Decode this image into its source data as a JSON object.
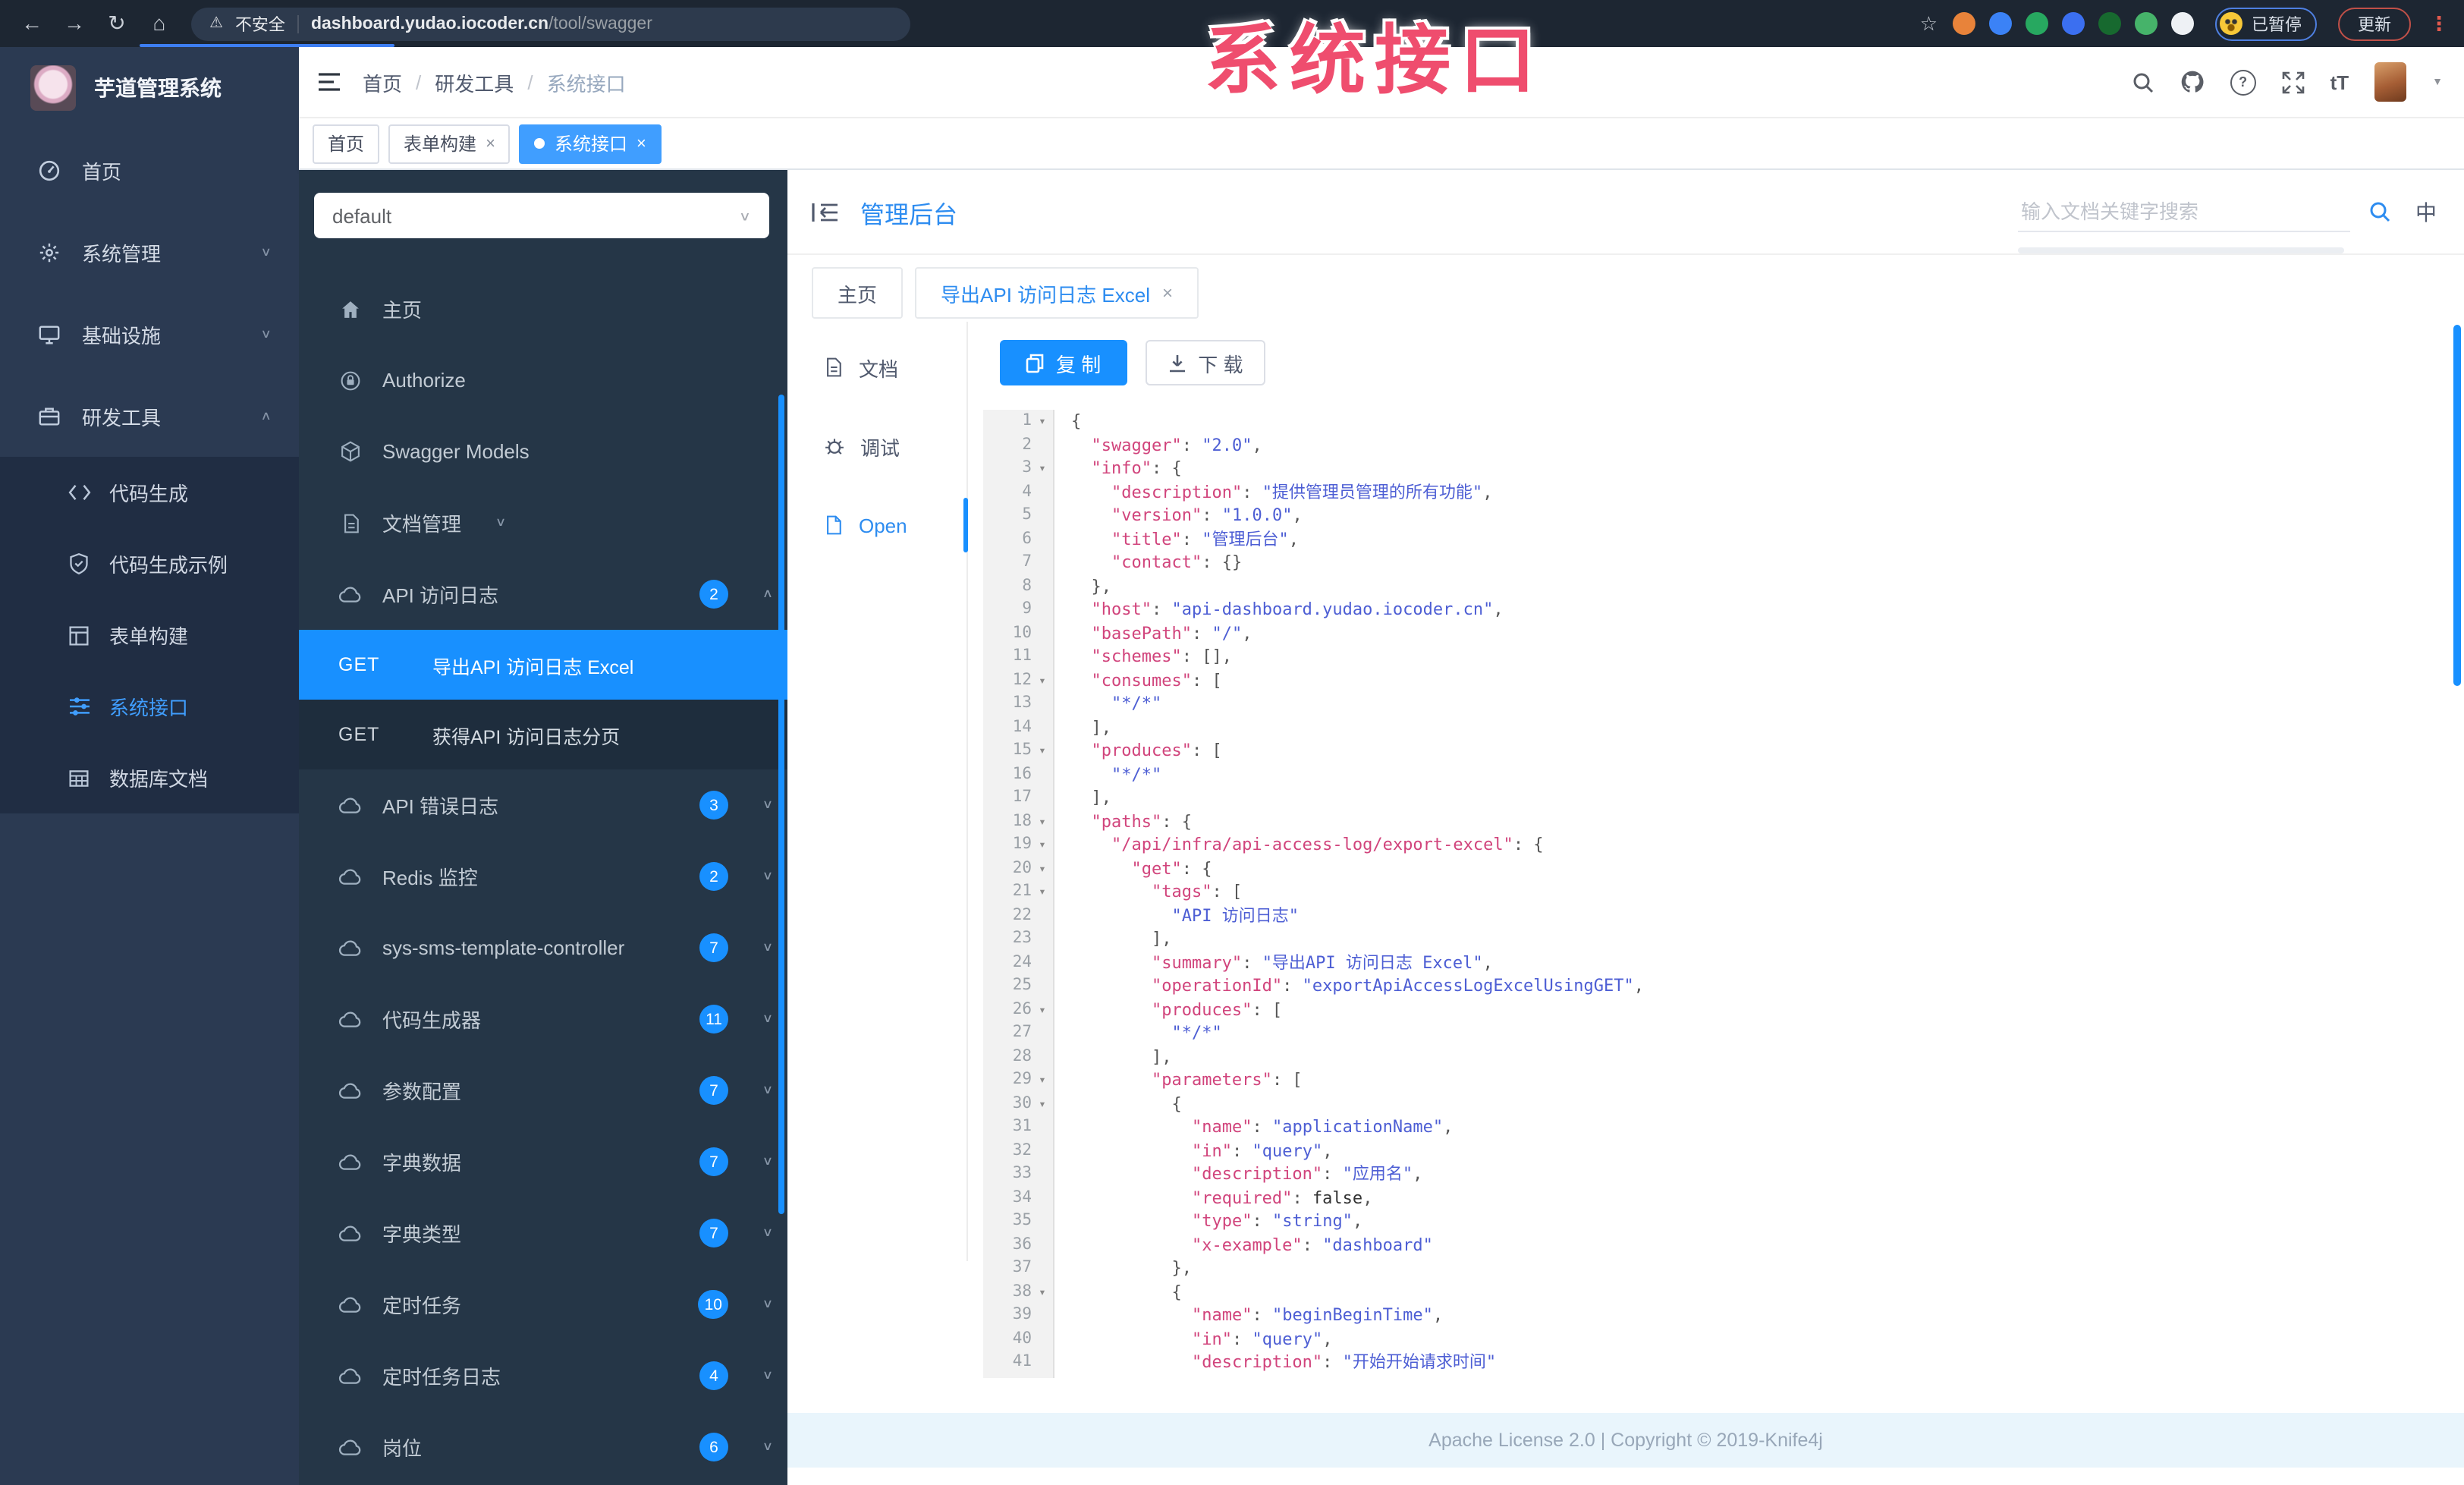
{
  "colors": {
    "accent": "#1890ff",
    "active_tag": "#409eff",
    "title": "#2d8cf0",
    "watermark": "#ef4d6e"
  },
  "browser": {
    "nav": [
      {
        "name": "back-icon",
        "glyph": "←"
      },
      {
        "name": "forward-icon",
        "glyph": "→"
      },
      {
        "name": "reload-icon",
        "glyph": "↻"
      },
      {
        "name": "home-icon",
        "glyph": "⌂"
      }
    ],
    "warning_glyph": "⚠",
    "security_label": "不安全",
    "url_host": "dashboard.yudao.iocoder.cn",
    "url_path": "/tool/swagger",
    "star_glyph": "☆",
    "extensions": [
      {
        "name": "ext-orange",
        "color": "#e8833a"
      },
      {
        "name": "ext-blue-drop",
        "color": "#3b82f6"
      },
      {
        "name": "ext-green-circle",
        "color": "#27a860"
      },
      {
        "name": "ext-blue-grid",
        "color": "#3b6ff0"
      },
      {
        "name": "ext-dark-green-box",
        "color": "#17692f"
      },
      {
        "name": "ext-green-leaf",
        "color": "#46b36a"
      },
      {
        "name": "ext-white-puzzle",
        "color": "#eef1f5"
      }
    ],
    "paused_label": "已暂停",
    "update_label": "更新",
    "menu_glyph": "⋮"
  },
  "watermark": {
    "text": "系统接口"
  },
  "app_sidebar": {
    "logo_title": "芋道管理系统",
    "items": [
      {
        "label": "首页",
        "icon": "dashboard"
      },
      {
        "label": "系统管理",
        "icon": "gear",
        "chevron": "down"
      },
      {
        "label": "基础设施",
        "icon": "monitor",
        "chevron": "down"
      },
      {
        "label": "研发工具",
        "icon": "briefcase",
        "chevron": "up"
      }
    ],
    "sub_items": [
      {
        "label": "代码生成",
        "icon": "code"
      },
      {
        "label": "代码生成示例",
        "icon": "shield"
      },
      {
        "label": "表单构建",
        "icon": "form"
      },
      {
        "label": "系统接口",
        "icon": "sliders",
        "active": true
      },
      {
        "label": "数据库文档",
        "icon": "table"
      }
    ]
  },
  "app_header": {
    "breadcrumb": [
      "首页",
      "研发工具",
      "系统接口"
    ],
    "separator": "/"
  },
  "tags_bar": {
    "tabs": [
      {
        "label": "首页"
      },
      {
        "label": "表单构建",
        "closable": true
      },
      {
        "label": "系统接口",
        "closable": true,
        "active": true
      }
    ]
  },
  "swagger_sidebar": {
    "group_select_value": "default",
    "items": [
      {
        "label": "主页",
        "icon": "home"
      },
      {
        "label": "Authorize",
        "icon": "lock"
      },
      {
        "label": "Swagger Models",
        "icon": "cube"
      },
      {
        "label": "文档管理",
        "icon": "file",
        "chevron": "down"
      },
      {
        "label": "API 访问日志",
        "icon": "cloud",
        "badge": "2",
        "chevron": "up",
        "children": [
          {
            "method": "GET",
            "label": "导出API 访问日志 Excel",
            "active": true
          },
          {
            "method": "GET",
            "label": "获得API 访问日志分页"
          }
        ]
      },
      {
        "label": "API 错误日志",
        "icon": "cloud",
        "badge": "3",
        "chevron": "down"
      },
      {
        "label": "Redis 监控",
        "icon": "cloud",
        "badge": "2",
        "chevron": "down"
      },
      {
        "label": "sys-sms-template-controller",
        "icon": "cloud",
        "badge": "7",
        "chevron": "down"
      },
      {
        "label": "代码生成器",
        "icon": "cloud",
        "badge": "11",
        "chevron": "down"
      },
      {
        "label": "参数配置",
        "icon": "cloud",
        "badge": "7",
        "chevron": "down"
      },
      {
        "label": "字典数据",
        "icon": "cloud",
        "badge": "7",
        "chevron": "down"
      },
      {
        "label": "字典类型",
        "icon": "cloud",
        "badge": "7",
        "chevron": "down"
      },
      {
        "label": "定时任务",
        "icon": "cloud",
        "badge": "10",
        "chevron": "down"
      },
      {
        "label": "定时任务日志",
        "icon": "cloud",
        "badge": "4",
        "chevron": "down"
      },
      {
        "label": "岗位",
        "icon": "cloud",
        "badge": "6",
        "chevron": "down"
      }
    ]
  },
  "main": {
    "title": "管理后台",
    "search_placeholder": "输入文档关键字搜索",
    "lang_label": "中",
    "tabs": [
      {
        "label": "主页"
      },
      {
        "label": "导出API 访问日志 Excel",
        "closable": true,
        "active": true
      }
    ],
    "doc_nav": [
      {
        "label": "文档",
        "icon": "file"
      },
      {
        "label": "调试",
        "icon": "debug"
      },
      {
        "label": "Open",
        "icon": "open",
        "active": true
      }
    ],
    "toolbar": {
      "copy_label": "复 制",
      "download_label": "下 载"
    },
    "footer": "Apache License 2.0 | Copyright © 2019-Knife4j"
  },
  "code": {
    "lines": [
      {
        "n": 1,
        "f": true,
        "t": [
          [
            "p",
            "{"
          ]
        ]
      },
      {
        "n": 2,
        "t": [
          [
            "p",
            "  "
          ],
          [
            "k",
            "swagger"
          ],
          [
            "p",
            ": "
          ],
          [
            "s",
            "2.0"
          ],
          [
            "p",
            ","
          ]
        ]
      },
      {
        "n": 3,
        "f": true,
        "t": [
          [
            "p",
            "  "
          ],
          [
            "k",
            "info"
          ],
          [
            "p",
            ": {"
          ]
        ]
      },
      {
        "n": 4,
        "t": [
          [
            "p",
            "    "
          ],
          [
            "k",
            "description"
          ],
          [
            "p",
            ": "
          ],
          [
            "s",
            "提供管理员管理的所有功能"
          ],
          [
            "p",
            ","
          ]
        ]
      },
      {
        "n": 5,
        "t": [
          [
            "p",
            "    "
          ],
          [
            "k",
            "version"
          ],
          [
            "p",
            ": "
          ],
          [
            "s",
            "1.0.0"
          ],
          [
            "p",
            ","
          ]
        ]
      },
      {
        "n": 6,
        "t": [
          [
            "p",
            "    "
          ],
          [
            "k",
            "title"
          ],
          [
            "p",
            ": "
          ],
          [
            "s",
            "管理后台"
          ],
          [
            "p",
            ","
          ]
        ]
      },
      {
        "n": 7,
        "t": [
          [
            "p",
            "    "
          ],
          [
            "k",
            "contact"
          ],
          [
            "p",
            ": {}"
          ]
        ]
      },
      {
        "n": 8,
        "t": [
          [
            "p",
            "  },"
          ]
        ]
      },
      {
        "n": 9,
        "t": [
          [
            "p",
            "  "
          ],
          [
            "k",
            "host"
          ],
          [
            "p",
            ": "
          ],
          [
            "s",
            "api-dashboard.yudao.iocoder.cn"
          ],
          [
            "p",
            ","
          ]
        ]
      },
      {
        "n": 10,
        "t": [
          [
            "p",
            "  "
          ],
          [
            "k",
            "basePath"
          ],
          [
            "p",
            ": "
          ],
          [
            "s",
            "/"
          ],
          [
            "p",
            ","
          ]
        ]
      },
      {
        "n": 11,
        "t": [
          [
            "p",
            "  "
          ],
          [
            "k",
            "schemes"
          ],
          [
            "p",
            ": [],"
          ]
        ]
      },
      {
        "n": 12,
        "f": true,
        "t": [
          [
            "p",
            "  "
          ],
          [
            "k",
            "consumes"
          ],
          [
            "p",
            ": ["
          ]
        ]
      },
      {
        "n": 13,
        "t": [
          [
            "p",
            "    "
          ],
          [
            "s",
            "*/*"
          ]
        ]
      },
      {
        "n": 14,
        "t": [
          [
            "p",
            "  ],"
          ]
        ]
      },
      {
        "n": 15,
        "f": true,
        "t": [
          [
            "p",
            "  "
          ],
          [
            "k",
            "produces"
          ],
          [
            "p",
            ": ["
          ]
        ]
      },
      {
        "n": 16,
        "t": [
          [
            "p",
            "    "
          ],
          [
            "s",
            "*/*"
          ]
        ]
      },
      {
        "n": 17,
        "t": [
          [
            "p",
            "  ],"
          ]
        ]
      },
      {
        "n": 18,
        "f": true,
        "t": [
          [
            "p",
            "  "
          ],
          [
            "k",
            "paths"
          ],
          [
            "p",
            ": {"
          ]
        ]
      },
      {
        "n": 19,
        "f": true,
        "t": [
          [
            "p",
            "    "
          ],
          [
            "k",
            "/api/infra/api-access-log/export-excel"
          ],
          [
            "p",
            ": {"
          ]
        ]
      },
      {
        "n": 20,
        "f": true,
        "t": [
          [
            "p",
            "      "
          ],
          [
            "k",
            "get"
          ],
          [
            "p",
            ": {"
          ]
        ]
      },
      {
        "n": 21,
        "f": true,
        "t": [
          [
            "p",
            "        "
          ],
          [
            "k",
            "tags"
          ],
          [
            "p",
            ": ["
          ]
        ]
      },
      {
        "n": 22,
        "t": [
          [
            "p",
            "          "
          ],
          [
            "s",
            "API 访问日志"
          ]
        ]
      },
      {
        "n": 23,
        "t": [
          [
            "p",
            "        ],"
          ]
        ]
      },
      {
        "n": 24,
        "t": [
          [
            "p",
            "        "
          ],
          [
            "k",
            "summary"
          ],
          [
            "p",
            ": "
          ],
          [
            "s",
            "导出API 访问日志 Excel"
          ],
          [
            "p",
            ","
          ]
        ]
      },
      {
        "n": 25,
        "t": [
          [
            "p",
            "        "
          ],
          [
            "k",
            "operationId"
          ],
          [
            "p",
            ": "
          ],
          [
            "s",
            "exportApiAccessLogExcelUsingGET"
          ],
          [
            "p",
            ","
          ]
        ]
      },
      {
        "n": 26,
        "f": true,
        "t": [
          [
            "p",
            "        "
          ],
          [
            "k",
            "produces"
          ],
          [
            "p",
            ": ["
          ]
        ]
      },
      {
        "n": 27,
        "t": [
          [
            "p",
            "          "
          ],
          [
            "s",
            "*/*"
          ]
        ]
      },
      {
        "n": 28,
        "t": [
          [
            "p",
            "        ],"
          ]
        ]
      },
      {
        "n": 29,
        "f": true,
        "t": [
          [
            "p",
            "        "
          ],
          [
            "k",
            "parameters"
          ],
          [
            "p",
            ": ["
          ]
        ]
      },
      {
        "n": 30,
        "f": true,
        "t": [
          [
            "p",
            "          {"
          ]
        ]
      },
      {
        "n": 31,
        "t": [
          [
            "p",
            "            "
          ],
          [
            "k",
            "name"
          ],
          [
            "p",
            ": "
          ],
          [
            "s",
            "applicationName"
          ],
          [
            "p",
            ","
          ]
        ]
      },
      {
        "n": 32,
        "t": [
          [
            "p",
            "            "
          ],
          [
            "k",
            "in"
          ],
          [
            "p",
            ": "
          ],
          [
            "s",
            "query"
          ],
          [
            "p",
            ","
          ]
        ]
      },
      {
        "n": 33,
        "t": [
          [
            "p",
            "            "
          ],
          [
            "k",
            "description"
          ],
          [
            "p",
            ": "
          ],
          [
            "s",
            "应用名"
          ],
          [
            "p",
            ","
          ]
        ]
      },
      {
        "n": 34,
        "t": [
          [
            "p",
            "            "
          ],
          [
            "k",
            "required"
          ],
          [
            "p",
            ": "
          ],
          [
            "l",
            "false"
          ],
          [
            "p",
            ","
          ]
        ]
      },
      {
        "n": 35,
        "t": [
          [
            "p",
            "            "
          ],
          [
            "k",
            "type"
          ],
          [
            "p",
            ": "
          ],
          [
            "s",
            "string"
          ],
          [
            "p",
            ","
          ]
        ]
      },
      {
        "n": 36,
        "t": [
          [
            "p",
            "            "
          ],
          [
            "k",
            "x-example"
          ],
          [
            "p",
            ": "
          ],
          [
            "s",
            "dashboard"
          ]
        ]
      },
      {
        "n": 37,
        "t": [
          [
            "p",
            "          },"
          ]
        ]
      },
      {
        "n": 38,
        "f": true,
        "t": [
          [
            "p",
            "          {"
          ]
        ]
      },
      {
        "n": 39,
        "t": [
          [
            "p",
            "            "
          ],
          [
            "k",
            "name"
          ],
          [
            "p",
            ": "
          ],
          [
            "s",
            "beginBeginTime"
          ],
          [
            "p",
            ","
          ]
        ]
      },
      {
        "n": 40,
        "t": [
          [
            "p",
            "            "
          ],
          [
            "k",
            "in"
          ],
          [
            "p",
            ": "
          ],
          [
            "s",
            "query"
          ],
          [
            "p",
            ","
          ]
        ]
      },
      {
        "n": 41,
        "t": [
          [
            "p",
            "            "
          ],
          [
            "k",
            "description"
          ],
          [
            "p",
            ": "
          ],
          [
            "s",
            "开始开始请求时间"
          ]
        ]
      }
    ]
  }
}
